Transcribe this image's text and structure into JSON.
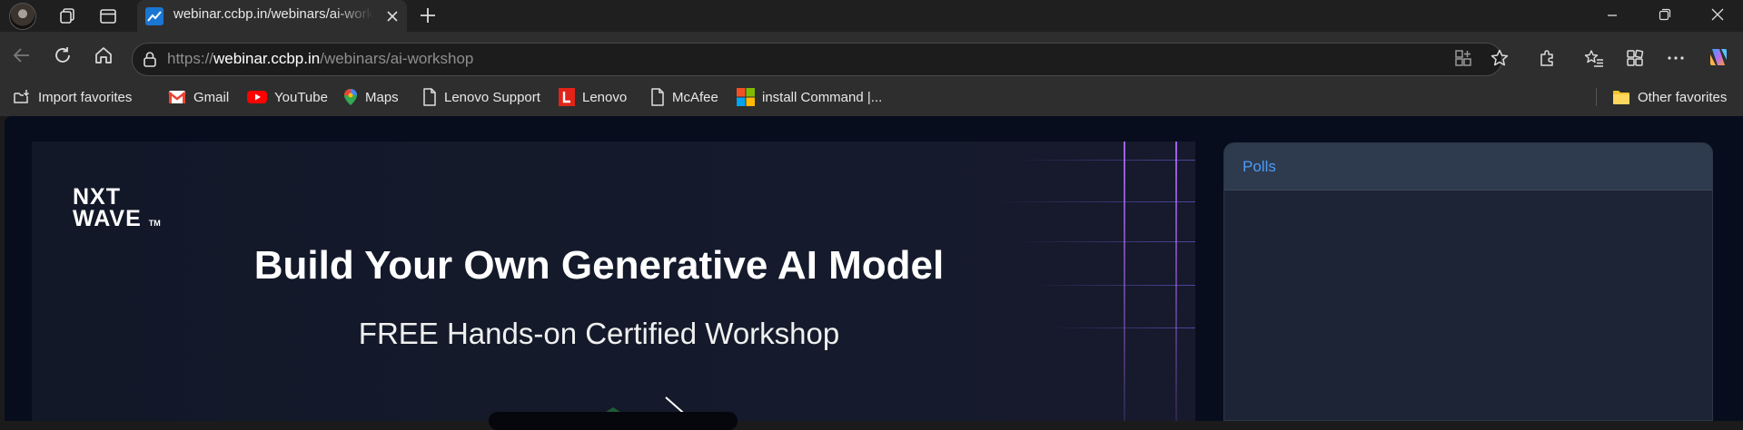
{
  "browser": {
    "tab": {
      "title": "webinar.ccbp.in/webinars/ai-workshop"
    },
    "address": {
      "protocol": "https://",
      "host": "webinar.ccbp.in",
      "path": "/webinars/ai-workshop"
    },
    "favorites": [
      {
        "label": "Import favorites",
        "icon": "import-icon"
      },
      {
        "label": "Gmail",
        "icon": "gmail-icon"
      },
      {
        "label": "YouTube",
        "icon": "youtube-icon"
      },
      {
        "label": "Maps",
        "icon": "maps-icon"
      },
      {
        "label": "Lenovo Support",
        "icon": "page-icon"
      },
      {
        "label": "Lenovo",
        "icon": "lenovo-icon"
      },
      {
        "label": "McAfee",
        "icon": "page-icon"
      },
      {
        "label": "install Command |...",
        "icon": "microsoft-icon"
      }
    ],
    "other_favorites": "Other favorites"
  },
  "banner": {
    "brand_line1": "NXT",
    "brand_line2": "WAVE",
    "brand_tm": "TM",
    "headline": "Build Your Own Generative AI Model",
    "subline": "FREE Hands-on Certified Workshop"
  },
  "polls": {
    "title": "Polls"
  },
  "colors": {
    "accent": "#4c9cf7",
    "page_bg": "#070d1c",
    "banner_bg": "#151b2c",
    "panel_bg": "#1c2435"
  }
}
